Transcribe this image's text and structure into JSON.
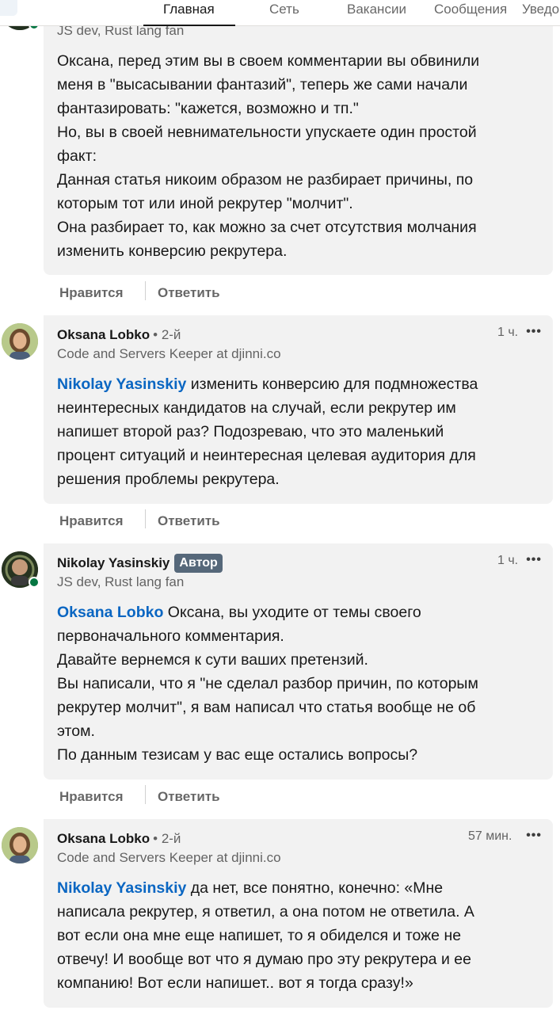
{
  "nav": {
    "items": [
      {
        "label": "Главная",
        "active": true
      },
      {
        "label": "Сеть",
        "active": false
      },
      {
        "label": "Вакансии",
        "active": false
      },
      {
        "label": "Сообщения",
        "active": false
      },
      {
        "label": "Уведо",
        "active": false
      }
    ]
  },
  "comments": [
    {
      "headline": "JS dev, Rust lang fan",
      "body": [
        "Оксана, перед этим вы в своем комментарии вы обвинили",
        "меня в \"высасывании фантазий\", теперь же сами начали",
        "фантазировать: \"кажется, возможно и тп.\"",
        "Но, вы в своей невнимательности упускаете один простой",
        "факт:",
        "Данная статья никоим образом не разбирает причины, по",
        "которым тот или иной рекрутер \"молчит\".",
        "Она разбирает то, как можно за счет отсутствия молчания",
        "изменить конверсию рекрутера."
      ],
      "like_label": "Нравится",
      "reply_label": "Ответить"
    },
    {
      "name": "Oksana Lobko",
      "degree": "• 2-й",
      "headline": "Code and Servers Keeper at djinni.co",
      "time": "1 ч.",
      "more": "•••",
      "mention": "Nikolay Yasinskiy",
      "body": [
        " изменить конверсию для подмножества",
        "неинтересных кандидатов на случай, если рекрутер им",
        "напишет второй раз? Подозреваю, что это маленький",
        "процент ситуаций и неинтересная целевая аудитория для",
        "решения проблемы рекрутера."
      ],
      "like_label": "Нравится",
      "reply_label": "Ответить"
    },
    {
      "name": "Nikolay Yasinskiy",
      "badge": "Автор",
      "headline": "JS dev, Rust lang fan",
      "time": "1 ч.",
      "more": "•••",
      "mention": "Oksana Lobko",
      "body": [
        " Оксана, вы уходите от темы своего",
        "первоначального комментария.",
        "Давайте вернемся к сути ваших претензий.",
        "Вы написали, что я \"не сделал разбор причин, по которым",
        "рекрутер молчит\", я вам написал что статья вообще не об",
        "этом.",
        "По данным тезисам у вас еще остались вопросы?"
      ],
      "like_label": "Нравится",
      "reply_label": "Ответить"
    },
    {
      "name": "Oksana Lobko",
      "degree": "• 2-й",
      "headline": "Code and Servers Keeper at djinni.co",
      "time": "57 мин.",
      "more": "•••",
      "mention": "Nikolay Yasinskiy",
      "body": [
        " да нет, все понятно, конечно: «Мне",
        "написала рекрутер, я ответил, а она потом не ответила. А",
        "вот если она мне еще напишет, то я обиделся и тоже не",
        "отвечу! И вообще вот что я думаю про эту рекрутера и ее",
        "компанию! Вот если напишет.. вот я тогда сразу!»"
      ]
    }
  ],
  "colors": {
    "mention": "#0a66c2",
    "bubble": "#f2f2f2",
    "presence": "#057642",
    "badge": "#56687a"
  }
}
